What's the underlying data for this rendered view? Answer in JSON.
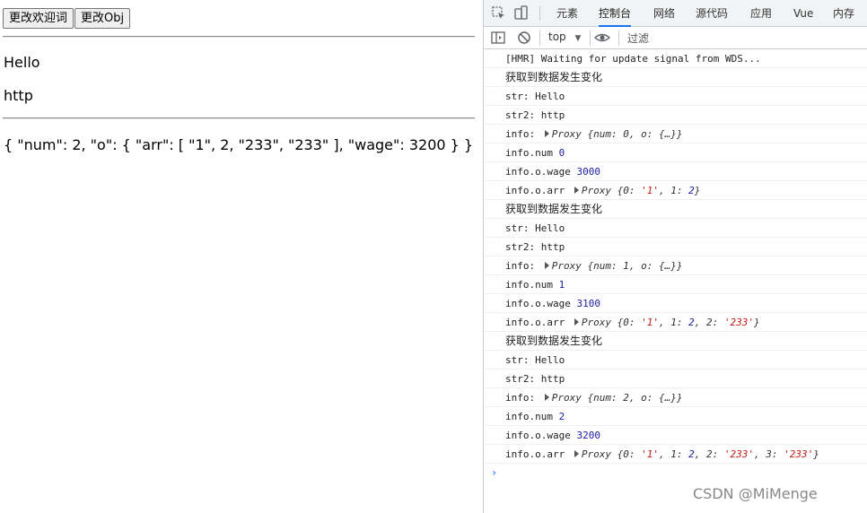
{
  "app": {
    "buttons": [
      "更改欢迎词",
      "更改Obj"
    ],
    "str": "Hello",
    "str2": "http",
    "info_json": "{ \"num\": 2, \"o\": { \"arr\": [ \"1\", 2, \"233\", \"233\" ], \"wage\": 3200 } }"
  },
  "devtools": {
    "tabs": [
      "元素",
      "控制台",
      "网络",
      "源代码",
      "应用",
      "Vue",
      "内存"
    ],
    "active_tab": "控制台",
    "context": "top",
    "filter_placeholder": "过滤",
    "accent": "#1a73e8"
  },
  "console": {
    "hmr": "[HMR] Waiting for update signal from WDS...",
    "change_msg": "获取到数据发生变化",
    "str_label": "str: ",
    "str_val": "Hello",
    "str2_label": "str2: ",
    "str2_val": "http",
    "info_label": "info: ",
    "num_label": "info.num",
    "wage_label": "info.o.wage",
    "arr_label": "info.o.arr",
    "proxy": "Proxy",
    "groups": [
      {
        "info_obj": "{num: 0, o: {…}}",
        "num": "0",
        "wage": "3000",
        "arr_pre": "{0: ",
        "arr_items": [
          "'1'",
          ", 1: ",
          "2"
        ],
        "arr_post": "}"
      },
      {
        "info_obj": "{num: 1, o: {…}}",
        "num": "1",
        "wage": "3100",
        "arr_pre": "{0: ",
        "arr_items": [
          "'1'",
          ", 1: ",
          "2",
          ", 2: ",
          "'233'"
        ],
        "arr_post": "}"
      },
      {
        "info_obj": "{num: 2, o: {…}}",
        "num": "2",
        "wage": "3200",
        "arr_pre": "{0: ",
        "arr_items": [
          "'1'",
          ", 1: ",
          "2",
          ", 2: ",
          "'233'",
          ", 3: ",
          "'233'"
        ],
        "arr_post": "}"
      }
    ],
    "prompt": "›"
  },
  "watermark": "CSDN @MiMenge"
}
